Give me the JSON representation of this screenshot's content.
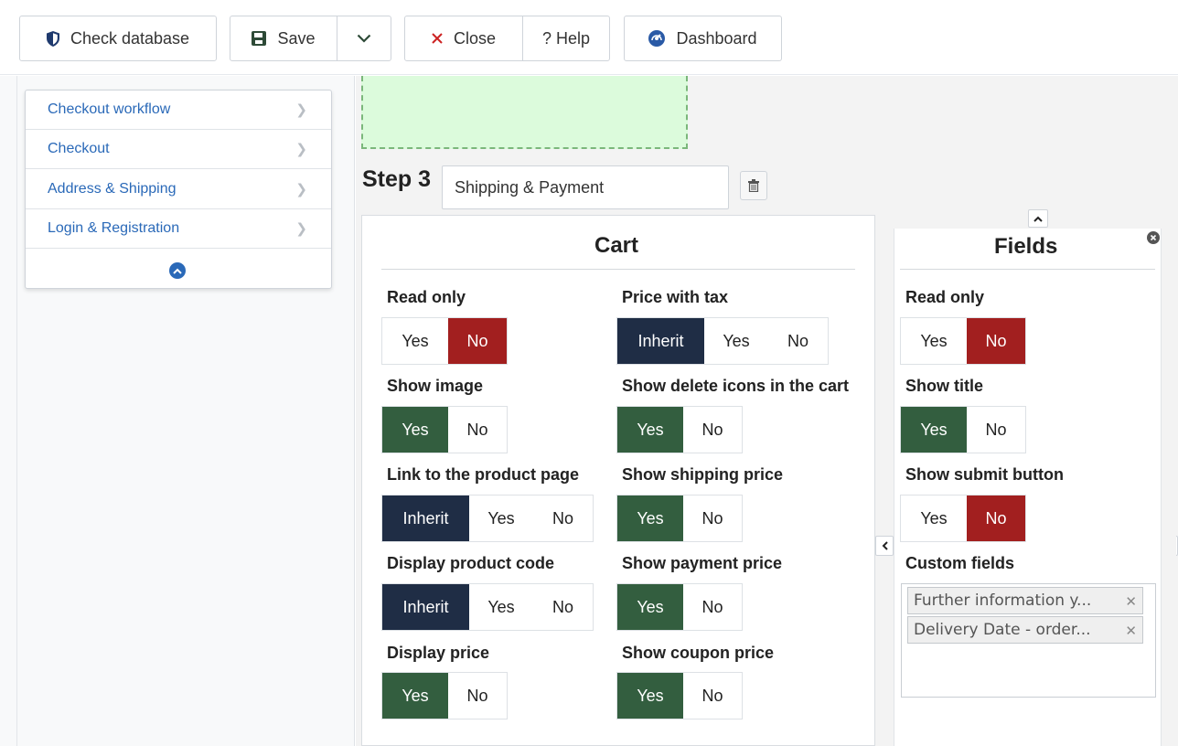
{
  "toolbar": {
    "check_database": "Check database",
    "save": "Save",
    "close": "Close",
    "help": "? Help",
    "dashboard": "Dashboard"
  },
  "nav": {
    "items": [
      {
        "label": "Checkout workflow"
      },
      {
        "label": "Checkout"
      },
      {
        "label": "Address & Shipping"
      },
      {
        "label": "Login & Registration"
      }
    ]
  },
  "step": {
    "label": "Step 3",
    "name_value": "Shipping & Payment"
  },
  "cart": {
    "title": "Cart",
    "read_only": {
      "label": "Read only",
      "options": [
        "Yes",
        "No"
      ],
      "selected": "No"
    },
    "show_image": {
      "label": "Show image",
      "options": [
        "Yes",
        "No"
      ],
      "selected": "Yes"
    },
    "link_product_page": {
      "label": "Link to the product page",
      "options": [
        "Inherit",
        "Yes",
        "No"
      ],
      "selected": "Inherit"
    },
    "display_product_code": {
      "label": "Display product code",
      "options": [
        "Inherit",
        "Yes",
        "No"
      ],
      "selected": "Inherit"
    },
    "display_price": {
      "label": "Display price",
      "options": [
        "Yes",
        "No"
      ],
      "selected": "Yes"
    },
    "price_with_tax": {
      "label": "Price with tax",
      "options": [
        "Inherit",
        "Yes",
        "No"
      ],
      "selected": "Inherit"
    },
    "show_delete_icons": {
      "label": "Show delete icons in the cart",
      "options": [
        "Yes",
        "No"
      ],
      "selected": "Yes"
    },
    "show_shipping_price": {
      "label": "Show shipping price",
      "options": [
        "Yes",
        "No"
      ],
      "selected": "Yes"
    },
    "show_payment_price": {
      "label": "Show payment price",
      "options": [
        "Yes",
        "No"
      ],
      "selected": "Yes"
    },
    "show_coupon_price": {
      "label": "Show coupon price",
      "options": [
        "Yes",
        "No"
      ],
      "selected": "Yes"
    }
  },
  "fields": {
    "title": "Fields",
    "read_only": {
      "label": "Read only",
      "options": [
        "Yes",
        "No"
      ],
      "selected": "No"
    },
    "show_title": {
      "label": "Show title",
      "options": [
        "Yes",
        "No"
      ],
      "selected": "Yes"
    },
    "show_submit_button": {
      "label": "Show submit button",
      "options": [
        "Yes",
        "No"
      ],
      "selected": "No"
    },
    "custom_fields": {
      "label": "Custom fields",
      "tags": [
        "Further information y...",
        "Delivery Date - order..."
      ]
    }
  },
  "colors": {
    "selected_no": "#a21f1f",
    "selected_yes": "#335e3f",
    "selected_inherit": "#1f2d45",
    "link": "#2a69b8",
    "dropzone": "#dcfbdc"
  }
}
